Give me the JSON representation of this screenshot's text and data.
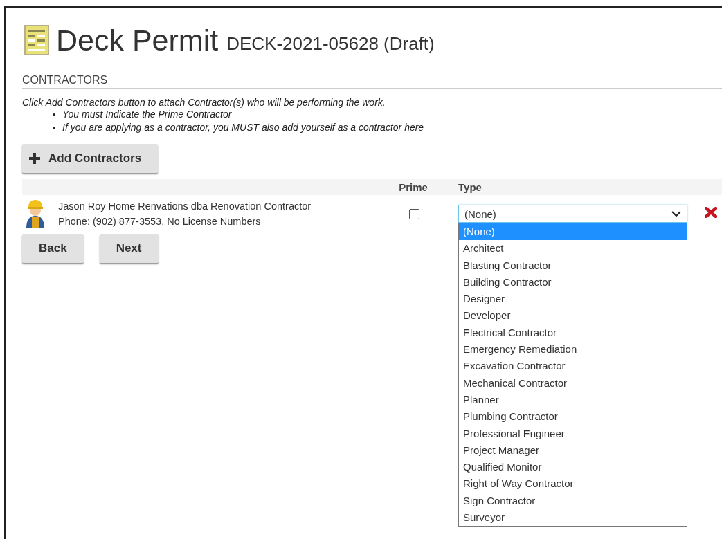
{
  "page": {
    "title": "Deck Permit",
    "record": "DECK-2021-05628 (Draft)"
  },
  "section": {
    "heading": "CONTRACTORS",
    "instruction": "Click Add Contractors button to attach Contractor(s) who will be performing the work.",
    "bullets": [
      "You must Indicate the Prime Contractor",
      "If you are applying as a contractor, you MUST also add yourself as a contractor here"
    ]
  },
  "add_button": {
    "label": "Add Contractors"
  },
  "table": {
    "columns": [
      "Prime",
      "Type"
    ],
    "rows": [
      {
        "name": "Jason Roy Home Renvations dba Renovation Contractor",
        "details": "Phone: (902) 877-3553, No License Numbers",
        "prime": false,
        "type": {
          "value": "(None)",
          "expanded": true,
          "options": [
            {
              "label": "(None)",
              "selected": true
            },
            {
              "label": "Architect",
              "selected": false
            },
            {
              "label": "Blasting Contractor",
              "selected": false
            },
            {
              "label": "Building Contractor",
              "selected": false
            },
            {
              "label": "Designer",
              "selected": false
            },
            {
              "label": "Developer",
              "selected": false
            },
            {
              "label": "Electrical Contractor",
              "selected": false
            },
            {
              "label": "Emergency Remediation",
              "selected": false
            },
            {
              "label": "Excavation Contractor",
              "selected": false
            },
            {
              "label": "Mechanical Contractor",
              "selected": false
            },
            {
              "label": "Planner",
              "selected": false
            },
            {
              "label": "Plumbing Contractor",
              "selected": false
            },
            {
              "label": "Professional Engineer",
              "selected": false
            },
            {
              "label": "Project Manager",
              "selected": false
            },
            {
              "label": "Qualified Monitor",
              "selected": false
            },
            {
              "label": "Right of Way Contractor",
              "selected": false
            },
            {
              "label": "Sign Contractor",
              "selected": false
            },
            {
              "label": "Surveyor",
              "selected": false
            }
          ]
        }
      }
    ]
  },
  "nav_buttons": [
    "Back",
    "Next"
  ]
}
